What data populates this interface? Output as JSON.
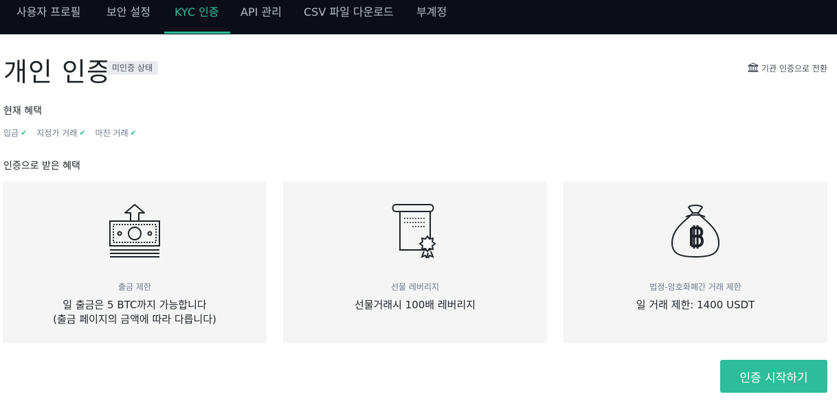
{
  "nav": {
    "tabs": [
      {
        "label": "사용자 프로필",
        "active": false
      },
      {
        "label": "보안 설정",
        "active": false
      },
      {
        "label": "KYC 인증",
        "active": true
      },
      {
        "label": "API 관리",
        "active": false
      },
      {
        "label": "CSV 파일 다운로드",
        "active": false
      },
      {
        "label": "부계정",
        "active": false
      }
    ]
  },
  "header": {
    "title": "개인 인증",
    "status_badge": "미인증 상태",
    "switch_link": "기관 인증으로 전환",
    "switch_icon": "bank-building-icon"
  },
  "current_benefits": {
    "title": "현재 혜택",
    "items": [
      "입금",
      "지정가 거래",
      "마진 거래"
    ],
    "check_icon": "check-icon"
  },
  "verified_benefits": {
    "title": "인증으로 받은 혜택",
    "cards": [
      {
        "icon": "withdraw-cash-icon",
        "label": "출금 제한",
        "value_line1": "일 출금은 5 BTC까지 가능합니다",
        "value_line2": "(출금 페이지의 금액에 따라 다릅니다)"
      },
      {
        "icon": "certificate-scroll-icon",
        "label": "선물 레버리지",
        "value_line1": "선물거래시 100배 레버리지",
        "value_line2": ""
      },
      {
        "icon": "bitcoin-bag-icon",
        "label": "법정-암호화폐간 거래 제한",
        "value_line1": "일 거래 제한: 1400 USDT",
        "value_line2": ""
      }
    ]
  },
  "actions": {
    "start_label": "인증 시작하기"
  },
  "colors": {
    "accent": "#2ebd9a",
    "nav_bg": "#0b0e19",
    "card_bg": "#f5f5f5"
  }
}
